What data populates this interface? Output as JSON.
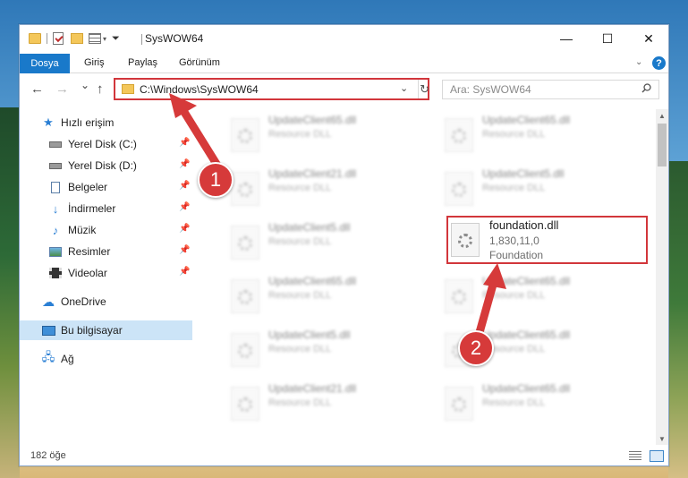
{
  "window": {
    "title": "SysWOW64",
    "minimize_glyph": "—",
    "maximize_glyph": "☐",
    "close_glyph": "✕"
  },
  "ribbon": {
    "file_tab": "Dosya",
    "tabs": [
      "Giriş",
      "Paylaş",
      "Görünüm"
    ],
    "help_glyph": "?"
  },
  "nav": {
    "back_glyph": "←",
    "forward_glyph": "→",
    "recent_glyph": "⌄",
    "up_glyph": "↑",
    "address": "C:\\Windows\\SysWOW64",
    "search_placeholder": "Ara: SysWOW64"
  },
  "sidebar": {
    "items": [
      {
        "label": "Hızlı erişim",
        "icon": "star-icon"
      },
      {
        "label": "Yerel Disk (C:)",
        "icon": "drive-icon",
        "pinned": true
      },
      {
        "label": "Yerel Disk (D:)",
        "icon": "drive-icon",
        "pinned": true
      },
      {
        "label": "Belgeler",
        "icon": "documents-icon",
        "pinned": true
      },
      {
        "label": "İndirmeler",
        "icon": "downloads-icon",
        "pinned": true
      },
      {
        "label": "Müzik",
        "icon": "music-icon",
        "pinned": true
      },
      {
        "label": "Resimler",
        "icon": "pictures-icon",
        "pinned": true
      },
      {
        "label": "Videolar",
        "icon": "videos-icon",
        "pinned": true
      },
      {
        "label": "OneDrive",
        "icon": "cloud-icon"
      },
      {
        "label": "Bu bilgisayar",
        "icon": "computer-icon",
        "selected": true
      },
      {
        "label": "Ağ",
        "icon": "network-icon"
      }
    ]
  },
  "files": {
    "left_column": [
      {
        "name": "UpdateClient65.dll",
        "desc": "Resource DLL"
      },
      {
        "name": "UpdateClient21.dll",
        "desc": "Resource DLL"
      },
      {
        "name": "UpdateClient5.dll",
        "desc": "Resource DLL"
      },
      {
        "name": "UpdateClient65.dll",
        "desc": "Resource DLL"
      },
      {
        "name": "UpdateClient5.dll",
        "desc": "Resource DLL"
      },
      {
        "name": "UpdateClient21.dll",
        "desc": "Resource DLL"
      }
    ],
    "right_column": [
      {
        "name": "UpdateClient65.dll",
        "desc": "Resource DLL"
      },
      {
        "name": "UpdateClient5.dll",
        "desc": "Resource DLL"
      },
      {
        "name": "foundation.dll",
        "version": "1,830,11,0",
        "desc": "Foundation",
        "highlighted": true
      },
      {
        "name": "UpdateClient65.dll",
        "desc": "Resource DLL"
      },
      {
        "name": "UpdateClient65.dll",
        "desc": "Resource DLL"
      },
      {
        "name": "UpdateClient65.dll",
        "desc": "Resource DLL"
      }
    ]
  },
  "status": {
    "item_count": "182 öğe"
  },
  "annotations": {
    "step1": "1",
    "step2": "2",
    "color": "#d63a3a"
  },
  "colors": {
    "accent": "#1979ca",
    "highlight_border": "#d2363b",
    "selected_bg": "#cce4f7"
  }
}
